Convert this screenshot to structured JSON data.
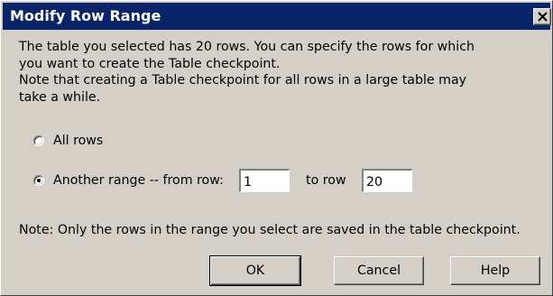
{
  "dialog": {
    "title": "Modify Row Range",
    "close_icon": "close-icon"
  },
  "description": {
    "line1": "The table you selected has 20  rows. You can specify the rows for which",
    "line2": "you want to create the Table checkpoint.",
    "line3": "Note that creating a Table checkpoint for all rows in a large table may",
    "line4": "take a while."
  },
  "options": {
    "all_rows_label": "All rows",
    "all_rows_selected": false,
    "another_range_label": "Another range -- from row:",
    "another_range_selected": true,
    "from_row_value": "1",
    "to_row_label": "to row",
    "to_row_value": "20"
  },
  "note": "Note: Only the rows in the range you select are saved in the table checkpoint.",
  "buttons": {
    "ok": "OK",
    "cancel": "Cancel",
    "help": "Help"
  },
  "colors": {
    "titlebar": "#0a246a",
    "face": "#d4d0c8"
  }
}
